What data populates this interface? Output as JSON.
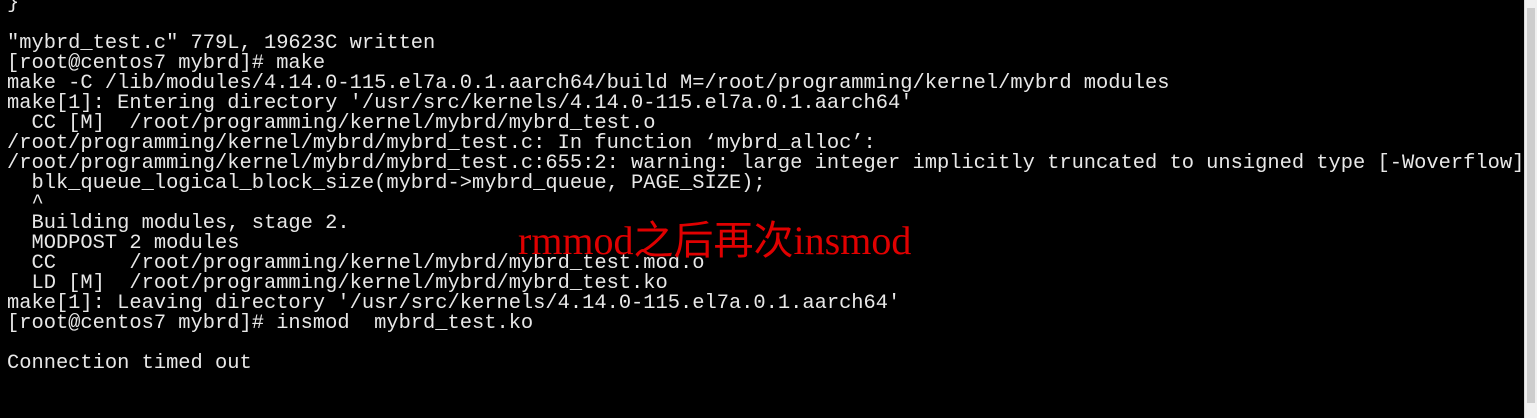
{
  "terminal": {
    "lines": [
      "}",
      "",
      "\"mybrd_test.c\" 779L, 19623C written",
      "[root@centos7 mybrd]# make",
      "make -C /lib/modules/4.14.0-115.el7a.0.1.aarch64/build M=/root/programming/kernel/mybrd modules",
      "make[1]: Entering directory '/usr/src/kernels/4.14.0-115.el7a.0.1.aarch64'",
      "  CC [M]  /root/programming/kernel/mybrd/mybrd_test.o",
      "/root/programming/kernel/mybrd/mybrd_test.c: In function ‘mybrd_alloc’:",
      "/root/programming/kernel/mybrd/mybrd_test.c:655:2: warning: large integer implicitly truncated to unsigned type [-Woverflow]",
      "  blk_queue_logical_block_size(mybrd->mybrd_queue, PAGE_SIZE);",
      "  ^",
      "  Building modules, stage 2.",
      "  MODPOST 2 modules",
      "  CC      /root/programming/kernel/mybrd/mybrd_test.mod.o",
      "  LD [M]  /root/programming/kernel/mybrd/mybrd_test.ko",
      "make[1]: Leaving directory '/usr/src/kernels/4.14.0-115.el7a.0.1.aarch64'",
      "[root@centos7 mybrd]# insmod  mybrd_test.ko",
      "",
      "Connection timed out"
    ]
  },
  "annotation": {
    "text": "rmmod之后再次insmod",
    "color": "#e00000"
  },
  "colors": {
    "background": "#000000",
    "foreground": "#e8e8e8"
  }
}
